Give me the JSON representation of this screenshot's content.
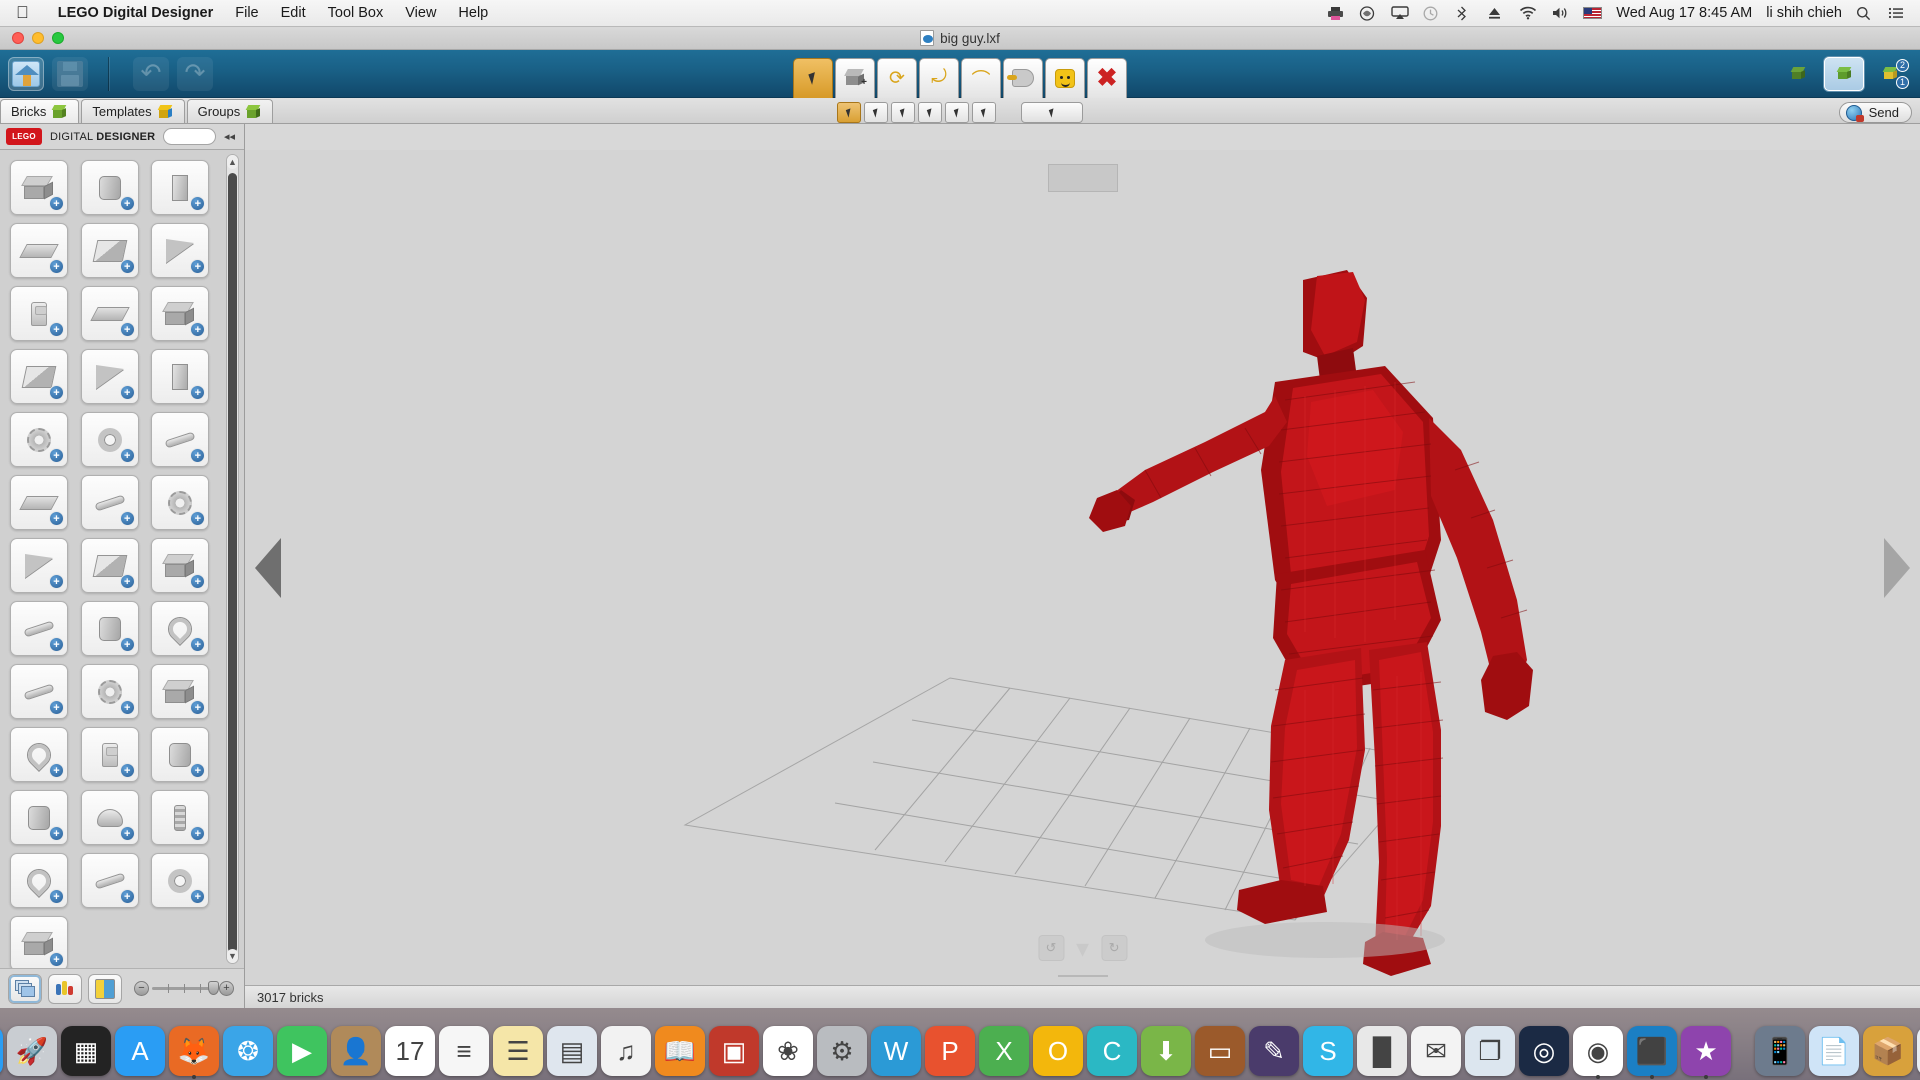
{
  "menubar": {
    "apple_icon": "apple-icon",
    "app_name": "LEGO Digital Designer",
    "menus": [
      "File",
      "Edit",
      "Tool Box",
      "View",
      "Help"
    ],
    "status_icons": [
      "printer-icon",
      "dropbox-icon",
      "airplay-icon",
      "time-machine-icon",
      "bluetooth-icon",
      "eject-icon",
      "wifi-icon",
      "volume-icon",
      "us-flag-icon"
    ],
    "datetime": "Wed Aug 17  8:45 AM",
    "user": "li shih chieh",
    "search_icon": "search-icon",
    "notification_icon": "notification-center-icon"
  },
  "window": {
    "title": "big guy.lxf",
    "title_icon": "lxf-document-icon",
    "traffic_lights": [
      "close-button",
      "minimize-button",
      "zoom-button"
    ]
  },
  "toolbar": {
    "left_buttons": [
      {
        "name": "home-button",
        "icon": "home-icon",
        "state": "selected"
      },
      {
        "name": "save-button",
        "icon": "floppy-disk-icon",
        "state": "disabled"
      }
    ],
    "history_buttons": [
      {
        "name": "undo-button",
        "icon": "undo-arrow-icon",
        "state": "disabled"
      },
      {
        "name": "redo-button",
        "icon": "redo-arrow-icon",
        "state": "disabled"
      }
    ],
    "tools": [
      {
        "name": "select-tool",
        "icon": "arrow-cursor-icon",
        "active": true
      },
      {
        "name": "clone-tool",
        "icon": "brick-plus-icon",
        "active": false
      },
      {
        "name": "hinge-tool",
        "icon": "hinge-rotate-icon",
        "active": false
      },
      {
        "name": "hinge-align-tool",
        "icon": "hinge-align-icon",
        "active": false
      },
      {
        "name": "flex-tool",
        "icon": "flex-hose-icon",
        "active": false
      },
      {
        "name": "paint-tool",
        "icon": "paint-bucket-icon",
        "active": false
      },
      {
        "name": "decorate-tool",
        "icon": "minifig-head-icon",
        "active": false
      },
      {
        "name": "delete-tool",
        "icon": "red-x-icon",
        "active": false
      }
    ],
    "view_modes": [
      {
        "name": "drag-view-button",
        "icon": "bricks-cursor-icon",
        "active": false
      },
      {
        "name": "room-view-button",
        "icon": "brick-room-icon",
        "active": true
      },
      {
        "name": "step-view-button",
        "icon": "brick-steps-icon",
        "active": false
      }
    ]
  },
  "tabs": [
    {
      "name": "tab-bricks",
      "label": "Bricks",
      "icon": "green-brick-icon",
      "active": true
    },
    {
      "name": "tab-templates",
      "label": "Templates",
      "icon": "templates-box-icon",
      "active": false
    },
    {
      "name": "tab-groups",
      "label": "Groups",
      "icon": "stacked-bricks-icon",
      "active": false
    }
  ],
  "subtoolbar": {
    "buttons": [
      {
        "name": "select-single-button",
        "icon": "cursor-icon",
        "active": true
      },
      {
        "name": "select-add-button",
        "icon": "cursor-plus-icon",
        "active": false
      },
      {
        "name": "select-connected-button",
        "icon": "cursor-connected-icon",
        "active": false
      },
      {
        "name": "select-color-button",
        "icon": "cursor-color-icon",
        "active": false
      },
      {
        "name": "select-shape-button",
        "icon": "cursor-shape-icon",
        "active": false
      },
      {
        "name": "select-color-shape-button",
        "icon": "cursor-color-shape-icon",
        "active": false
      }
    ],
    "wide_button": {
      "name": "select-all-button",
      "icon": "cursor-grid-icon"
    }
  },
  "send_button": {
    "name": "send-button",
    "label": "Send",
    "icon": "globe-upload-icon"
  },
  "palette": {
    "logo_text": "LEGO",
    "title_light": "DIGITAL",
    "title_bold": "DESIGNER",
    "search_placeholder": "",
    "search_value": "",
    "collapse_icon": "collapse-left-icon",
    "bricks": [
      {
        "name": "brick-2x4",
        "shape": "g-basic"
      },
      {
        "name": "brick-round-2x2",
        "shape": "g-cyl"
      },
      {
        "name": "brick-bracket",
        "shape": "g-tall"
      },
      {
        "name": "brick-1x4",
        "shape": "g-plate"
      },
      {
        "name": "slope-brick",
        "shape": "g-slope"
      },
      {
        "name": "wedge-brick",
        "shape": "g-wedge"
      },
      {
        "name": "brick-1x1",
        "shape": "g-mini"
      },
      {
        "name": "plate-2x4",
        "shape": "g-plate"
      },
      {
        "name": "tile-plate",
        "shape": "g-basic"
      },
      {
        "name": "arch-brick",
        "shape": "g-slope"
      },
      {
        "name": "curved-slope",
        "shape": "g-wedge"
      },
      {
        "name": "panel-brick",
        "shape": "g-tall"
      },
      {
        "name": "technic-gear",
        "shape": "g-gear"
      },
      {
        "name": "technic-wheel",
        "shape": "g-ring"
      },
      {
        "name": "technic-beam",
        "shape": "g-bar"
      },
      {
        "name": "plate-modified",
        "shape": "g-plate"
      },
      {
        "name": "technic-axle",
        "shape": "g-bar"
      },
      {
        "name": "turntable-gear",
        "shape": "g-gear"
      },
      {
        "name": "wedge-plate",
        "shape": "g-wedge"
      },
      {
        "name": "slope-inverted",
        "shape": "g-slope"
      },
      {
        "name": "brick-modified",
        "shape": "g-basic"
      },
      {
        "name": "wrench-part",
        "shape": "g-bar"
      },
      {
        "name": "megaphone-part",
        "shape": "g-cyl"
      },
      {
        "name": "horseshoe-part",
        "shape": "g-hook"
      },
      {
        "name": "tool-part",
        "shape": "g-bar"
      },
      {
        "name": "gear-assembly",
        "shape": "g-gear"
      },
      {
        "name": "grille-brick",
        "shape": "g-basic"
      },
      {
        "name": "hook-part",
        "shape": "g-hook"
      },
      {
        "name": "minifig-torso",
        "shape": "g-mini"
      },
      {
        "name": "cone-part",
        "shape": "g-cyl"
      },
      {
        "name": "bucket-part",
        "shape": "g-cyl"
      },
      {
        "name": "helmet-part",
        "shape": "g-helmet"
      },
      {
        "name": "spring-part",
        "shape": "g-coil"
      },
      {
        "name": "handle-part",
        "shape": "g-hook"
      },
      {
        "name": "screwdriver-part",
        "shape": "g-bar"
      },
      {
        "name": "headset-part",
        "shape": "g-ring"
      },
      {
        "name": "misc-part",
        "shape": "g-basic"
      }
    ],
    "footer": {
      "buttons": [
        {
          "name": "brick-palette-button",
          "icon": "brick-stack-icon",
          "active": true
        },
        {
          "name": "color-palette-button",
          "icon": "color-palette-icon",
          "active": false
        },
        {
          "name": "catalog-button",
          "icon": "catalog-book-icon",
          "active": false
        }
      ],
      "zoom": {
        "name": "palette-zoom-slider",
        "minus_icon": "minus-icon",
        "plus_icon": "plus-icon"
      }
    }
  },
  "canvas": {
    "nav_left_icon": "previous-view-arrow",
    "nav_right_icon": "next-view-arrow",
    "model_name": "red-lego-human-figure",
    "grip_top": "top-drag-handle",
    "grip_rotate_left": "rotate-left-icon",
    "grip_chevron": "chevron-down-icon",
    "grip_rotate_right": "rotate-right-icon"
  },
  "statusbar": {
    "text": "3017 bricks"
  },
  "dock": {
    "items": [
      {
        "name": "dock-finder",
        "label": "Finder",
        "glyph": "🙂",
        "bg": "#2a9df4",
        "running": true
      },
      {
        "name": "dock-launchpad",
        "label": "Launchpad",
        "glyph": "🚀",
        "bg": "#c9cdd2",
        "running": false
      },
      {
        "name": "dock-mission-control",
        "label": "Mission Control",
        "glyph": "▦",
        "bg": "#232323",
        "running": false
      },
      {
        "name": "dock-app-store",
        "label": "App Store",
        "glyph": "A",
        "bg": "#2a9df4",
        "running": false
      },
      {
        "name": "dock-firefox",
        "label": "Firefox",
        "glyph": "🦊",
        "bg": "#e96a24",
        "running": true
      },
      {
        "name": "dock-safari",
        "label": "Safari",
        "glyph": "❂",
        "bg": "#3aa5e8",
        "running": false
      },
      {
        "name": "dock-facetime",
        "label": "FaceTime",
        "glyph": "▶",
        "bg": "#3fc45f",
        "running": false
      },
      {
        "name": "dock-contacts",
        "label": "Contacts",
        "glyph": "👤",
        "bg": "#b08a5a",
        "running": false
      },
      {
        "name": "dock-calendar",
        "label": "Calendar",
        "glyph": "17",
        "bg": "#ffffff",
        "running": false
      },
      {
        "name": "dock-reminders",
        "label": "Reminders",
        "glyph": "≡",
        "bg": "#f6f6f6",
        "running": false
      },
      {
        "name": "dock-notes",
        "label": "Notes",
        "glyph": "☰",
        "bg": "#f5e6a8",
        "running": false
      },
      {
        "name": "dock-iweb",
        "label": "iWeb",
        "glyph": "▤",
        "bg": "#dfe6ee",
        "running": false
      },
      {
        "name": "dock-itunes",
        "label": "iTunes",
        "glyph": "♫",
        "bg": "#f2f2f2",
        "running": false
      },
      {
        "name": "dock-ibooks",
        "label": "iBooks",
        "glyph": "📖",
        "bg": "#f08a1e",
        "running": false
      },
      {
        "name": "dock-iphoto",
        "label": "iPhoto",
        "glyph": "▣",
        "bg": "#c0392b",
        "running": false
      },
      {
        "name": "dock-photos",
        "label": "Photos",
        "glyph": "❀",
        "bg": "#ffffff",
        "running": false
      },
      {
        "name": "dock-system-preferences",
        "label": "System Preferences",
        "glyph": "⚙",
        "bg": "#b9bcc0",
        "running": false
      },
      {
        "name": "dock-word",
        "label": "Microsoft Word",
        "glyph": "W",
        "bg": "#2b9ad6",
        "running": false
      },
      {
        "name": "dock-powerpoint",
        "label": "PowerPoint",
        "glyph": "P",
        "bg": "#e8522f",
        "running": false
      },
      {
        "name": "dock-excel",
        "label": "Excel",
        "glyph": "X",
        "bg": "#4caf50",
        "running": false
      },
      {
        "name": "dock-outlook",
        "label": "Outlook",
        "glyph": "O",
        "bg": "#f3b70c",
        "running": false
      },
      {
        "name": "dock-onedrive",
        "label": "OneDrive",
        "glyph": "C",
        "bg": "#2bb8c4",
        "running": false
      },
      {
        "name": "dock-downloader",
        "label": "Downloader",
        "glyph": "⬇",
        "bg": "#7ab648",
        "running": false
      },
      {
        "name": "dock-keynote",
        "label": "Keynote",
        "glyph": "▭",
        "bg": "#9b5a2b",
        "running": false
      },
      {
        "name": "dock-pages",
        "label": "Pages",
        "glyph": "✎",
        "bg": "#4a3b6b",
        "running": false
      },
      {
        "name": "dock-skype",
        "label": "Skype",
        "glyph": "S",
        "bg": "#31b6e7",
        "running": false
      },
      {
        "name": "dock-numbers",
        "label": "Numbers",
        "glyph": "█",
        "bg": "#e8e8e8",
        "running": false
      },
      {
        "name": "dock-mail",
        "label": "Mail",
        "glyph": "✉",
        "bg": "#f3f3f3",
        "running": false
      },
      {
        "name": "dock-image-capture",
        "label": "Image Capture",
        "glyph": "❐",
        "bg": "#dce6ef",
        "running": false
      },
      {
        "name": "dock-dvd-player",
        "label": "DVD Player",
        "glyph": "◎",
        "bg": "#1b2a44",
        "running": false
      },
      {
        "name": "dock-chrome",
        "label": "Google Chrome",
        "glyph": "◉",
        "bg": "#ffffff",
        "running": true
      },
      {
        "name": "dock-lego-digital-designer",
        "label": "LEGO Digital Designer",
        "glyph": "⬛",
        "bg": "#1b7fc4",
        "running": true
      },
      {
        "name": "dock-imovie",
        "label": "iMovie",
        "glyph": "★",
        "bg": "#8e44ad",
        "running": true
      }
    ],
    "separator": "dock-separator",
    "trash_items": [
      {
        "name": "dock-iphone-backup",
        "label": "iPhone Transfer",
        "glyph": "📱",
        "bg": "#6d7b8d"
      },
      {
        "name": "dock-documents-stack",
        "label": "Documents",
        "glyph": "📄",
        "bg": "#cfe4f7"
      },
      {
        "name": "dock-downloads-stack",
        "label": "Downloads",
        "glyph": "📦",
        "bg": "#d8a13c"
      },
      {
        "name": "dock-trash",
        "label": "Trash",
        "glyph": "🗑",
        "bg": "#e8eef3"
      }
    ]
  }
}
